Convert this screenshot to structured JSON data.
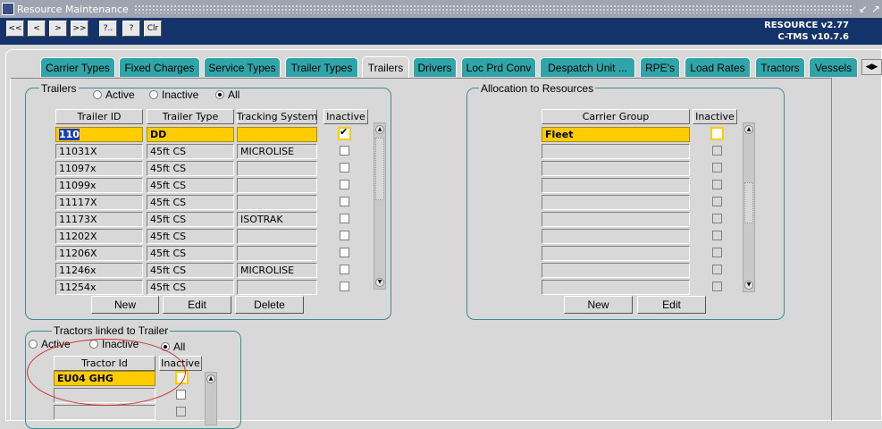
{
  "window": {
    "title": "Resource Maintenance"
  },
  "toolbar": {
    "buttons": [
      "<<",
      "<",
      ">",
      ">>",
      "?..",
      "?",
      "Clr"
    ],
    "version_line1": "RESOURCE v2.77",
    "version_line2": "C-TMS v10.7.6"
  },
  "tabs": [
    {
      "label": "Carrier Types",
      "active": false
    },
    {
      "label": "Fixed Charges",
      "active": false
    },
    {
      "label": "Service Types",
      "active": false
    },
    {
      "label": "Trailer Types",
      "active": false
    },
    {
      "label": "Trailers",
      "active": true
    },
    {
      "label": "Drivers",
      "active": false
    },
    {
      "label": "Loc Prd Conv",
      "active": false
    },
    {
      "label": "Despatch Unit ...",
      "active": false
    },
    {
      "label": "RPE's",
      "active": false
    },
    {
      "label": "Load Rates",
      "active": false
    },
    {
      "label": "Tractors",
      "active": false
    },
    {
      "label": "Vessels",
      "active": false
    }
  ],
  "trailers": {
    "title": "Trailers",
    "filter": {
      "active": "Active",
      "inactive": "Inactive",
      "all": "All",
      "selected": "All"
    },
    "columns": {
      "trailer_id": "Trailer ID",
      "trailer_type": "Trailer Type",
      "tracking_system": "Tracking System",
      "inactive": "Inactive"
    },
    "rows": [
      {
        "id": "110",
        "type": "DD",
        "tracking": "",
        "inactive": true
      },
      {
        "id": "11031X",
        "type": "45ft CS",
        "tracking": "MICROLISE",
        "inactive": false
      },
      {
        "id": "11097x",
        "type": "45ft CS",
        "tracking": "",
        "inactive": false
      },
      {
        "id": "11099x",
        "type": "45ft CS",
        "tracking": "",
        "inactive": false
      },
      {
        "id": "11117X",
        "type": "45ft CS",
        "tracking": "",
        "inactive": false
      },
      {
        "id": "11173X",
        "type": "45ft CS",
        "tracking": "ISOTRAK",
        "inactive": false
      },
      {
        "id": "11202X",
        "type": "45ft CS",
        "tracking": "",
        "inactive": false
      },
      {
        "id": "11206X",
        "type": "45ft CS",
        "tracking": "",
        "inactive": false
      },
      {
        "id": "11246x",
        "type": "45ft CS",
        "tracking": "MICROLISE",
        "inactive": false
      },
      {
        "id": "11254x",
        "type": "45ft CS",
        "tracking": "",
        "inactive": false
      }
    ],
    "buttons": {
      "new": "New",
      "edit": "Edit",
      "delete": "Delete"
    }
  },
  "allocation": {
    "title": "Allocation to Resources",
    "columns": {
      "carrier_group": "Carrier Group",
      "inactive": "Inactive"
    },
    "rows": [
      "Fleet",
      "",
      "",
      "",
      "",
      "",
      "",
      "",
      "",
      ""
    ],
    "buttons": {
      "new": "New",
      "edit": "Edit"
    }
  },
  "tractors": {
    "title": "Tractors linked to Trailer",
    "filter": {
      "active": "Active",
      "inactive": "Inactive",
      "all": "All",
      "selected": "All"
    },
    "columns": {
      "tractor_id": "Tractor Id",
      "inactive": "Inactive"
    },
    "rows": [
      "EU04 GHG",
      "",
      ""
    ]
  },
  "colors": {
    "selection": "#ffcc00",
    "tab": "#2fa5a9",
    "toolbar": "#14336b",
    "highlight": "#1a3fb6",
    "annotation": "#d03030"
  }
}
